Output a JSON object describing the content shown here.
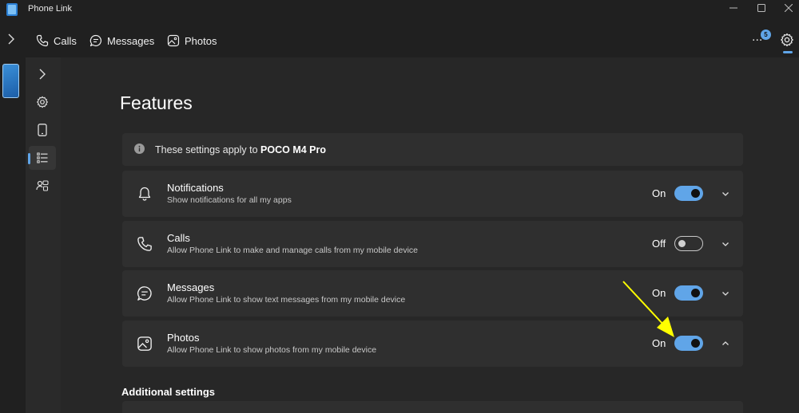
{
  "window": {
    "title": "Phone Link",
    "controls": [
      "minimize-icon",
      "maximize-icon",
      "close-icon"
    ]
  },
  "topnav": {
    "tabs": [
      {
        "label": "Calls",
        "icon": "phone-icon"
      },
      {
        "label": "Messages",
        "icon": "message-icon"
      },
      {
        "label": "Photos",
        "icon": "photo-icon"
      }
    ],
    "more_label": "...",
    "notification_count": "5"
  },
  "sidebar": {
    "items": [
      "chevron-right-icon",
      "settings-icon",
      "phone-device-icon",
      "features-list-icon",
      "personalization-icon"
    ],
    "active_index": 3
  },
  "page": {
    "title": "Features",
    "info_prefix": "These settings apply to ",
    "device_name": "POCO M4 Pro",
    "additional_settings_label": "Additional settings"
  },
  "features": [
    {
      "title": "Notifications",
      "description": "Show notifications for all my apps",
      "state": "On",
      "enabled": true,
      "expanded": false
    },
    {
      "title": "Calls",
      "description": "Allow Phone Link to make and manage calls from my mobile device",
      "state": "Off",
      "enabled": false,
      "expanded": false
    },
    {
      "title": "Messages",
      "description": "Allow Phone Link to show text messages from my mobile device",
      "state": "On",
      "enabled": true,
      "expanded": false
    },
    {
      "title": "Photos",
      "description": "Allow Phone Link to show photos from my mobile device",
      "state": "On",
      "enabled": true,
      "expanded": true
    }
  ],
  "colors": {
    "accent": "#60a5e8",
    "background": "#202020",
    "card": "#2f2f2f",
    "annotation": "#ffff00"
  }
}
